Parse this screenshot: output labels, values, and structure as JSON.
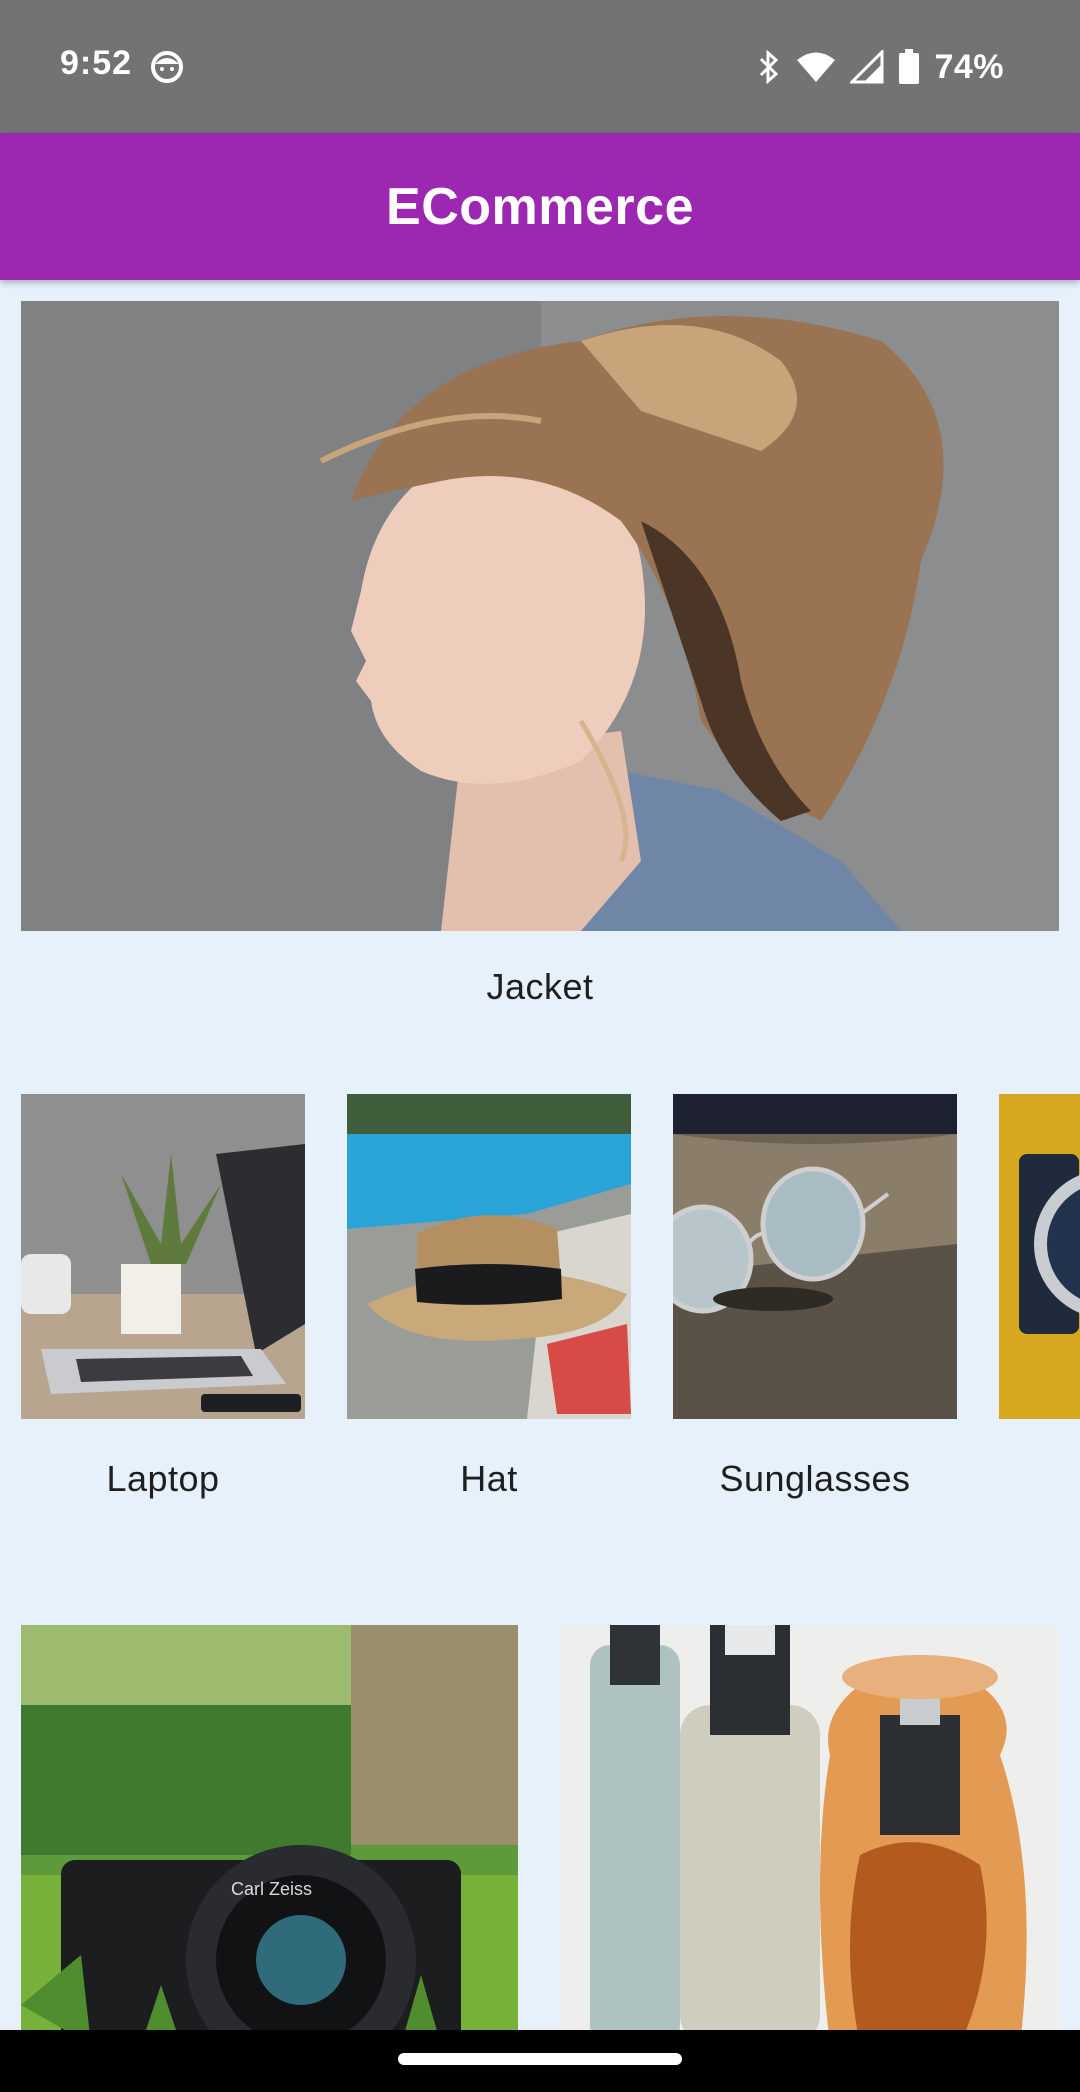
{
  "status_bar": {
    "time": "9:52",
    "battery": "74%",
    "icons": [
      "face-icon",
      "bluetooth-icon",
      "wifi-icon",
      "signal-icon",
      "battery-icon"
    ]
  },
  "app_bar": {
    "title": "ECommerce"
  },
  "featured": {
    "label": "Jacket"
  },
  "carousel": {
    "items": [
      {
        "label": "Laptop"
      },
      {
        "label": "Hat"
      },
      {
        "label": "Sunglasses"
      },
      {
        "label": ""
      }
    ]
  },
  "grid": {
    "items": [
      {
        "label": ""
      },
      {
        "label": ""
      }
    ]
  },
  "colors": {
    "primary": "#9c27b0",
    "background": "#e6f1fb",
    "status_bar": "#737373"
  }
}
